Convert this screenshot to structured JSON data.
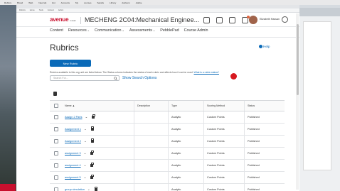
{
  "mac_menubar": {
    "items": [
      "Rubrics",
      "Brand",
      "Web",
      "New tab",
      "Ext",
      "Accounts",
      "My",
      "courses",
      "Sarahs",
      "Library",
      "Advisors",
      "Adobe"
    ]
  },
  "browser_nav": {
    "items": [
      "Rubrics",
      "Home",
      "Tools",
      "Content",
      "Admin"
    ]
  },
  "header": {
    "logo_brand": "avenue",
    "logo_sub": "to learn",
    "course_title": "MECHENG 2C04:Mechanical Enginee...",
    "username": "Elizabeth Hassan"
  },
  "menu": {
    "items": [
      {
        "label": "Content",
        "has_dropdown": false
      },
      {
        "label": "Resources",
        "has_dropdown": true
      },
      {
        "label": "Communication",
        "has_dropdown": true
      },
      {
        "label": "Assessments",
        "has_dropdown": true
      },
      {
        "label": "PebblePad",
        "has_dropdown": false
      },
      {
        "label": "Course Admin",
        "has_dropdown": false
      }
    ]
  },
  "page": {
    "title": "Rubrics",
    "help_label": "Help",
    "new_button": "New Rubric",
    "description": "Rubrics available to this org unit are listed below. The Status column indicates the status of each rubric and affects how it can be used.",
    "description_link": "What is a rubric status?",
    "search_placeholder": "Search For...",
    "search_options": "Show Search Options"
  },
  "table": {
    "headers": {
      "name": "Name ▲",
      "description": "Description",
      "type": "Type",
      "scoring": "Scoring Method",
      "status": "Status"
    },
    "rows": [
      {
        "name": "Assign 2 Parts",
        "description": "",
        "type": "Analytic",
        "scoring": "Custom Points",
        "status": "Published"
      },
      {
        "name": "Assignment 1",
        "description": "",
        "type": "Analytic",
        "scoring": "Custom Points",
        "status": "Published"
      },
      {
        "name": "Assignment 2",
        "description": "",
        "type": "Analytic",
        "scoring": "Custom Points",
        "status": "Published"
      },
      {
        "name": "assignment 3",
        "description": "",
        "type": "Analytic",
        "scoring": "Custom Points",
        "status": "Published"
      },
      {
        "name": "assignment 4",
        "description": "",
        "type": "Analytic",
        "scoring": "Custom Points",
        "status": "Published"
      },
      {
        "name": "assignment 5",
        "description": "",
        "type": "Analytic",
        "scoring": "Custom Points",
        "status": "Published"
      },
      {
        "name": "group simulation",
        "description": "",
        "type": "Analytic",
        "scoring": "Custom Points",
        "status": "Published"
      }
    ]
  },
  "colors": {
    "link_blue": "#0a6ab8",
    "brand_red": "#c8102e",
    "cursor_red": "#d71920"
  }
}
